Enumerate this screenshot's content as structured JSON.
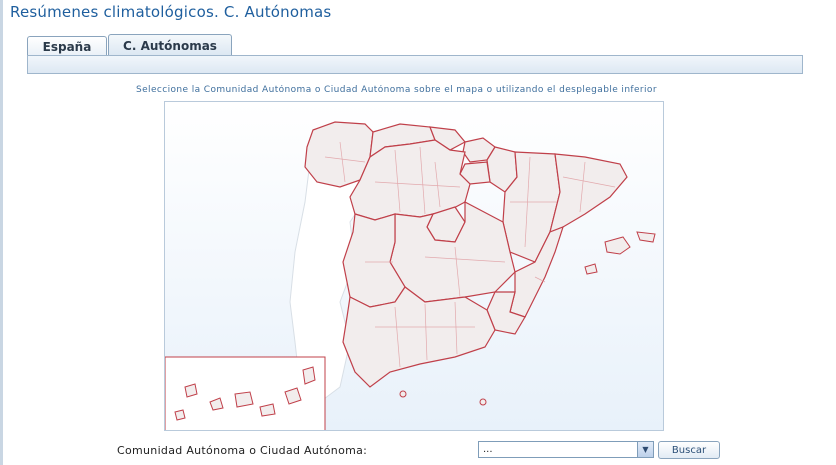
{
  "page": {
    "title": "Resúmenes climatológicos. C. Autónomas"
  },
  "tabs": [
    {
      "label": "España",
      "active": false
    },
    {
      "label": "C. Autónomas",
      "active": true
    }
  ],
  "instruction": "Seleccione la Comunidad Autónoma o Ciudad Autónoma sobre el mapa o utilizando el desplegable inferior",
  "map": {
    "fill_color": "#f2eded",
    "border_color": "#c0404a",
    "inner_border_color": "#e2a9ad"
  },
  "form": {
    "label": "Comunidad Autónoma o Ciudad Autónoma:",
    "select_value": "...",
    "search_label": "Buscar"
  },
  "colors": {
    "title": "#1f5f9e",
    "accent_blue": "#3f6f9d"
  }
}
